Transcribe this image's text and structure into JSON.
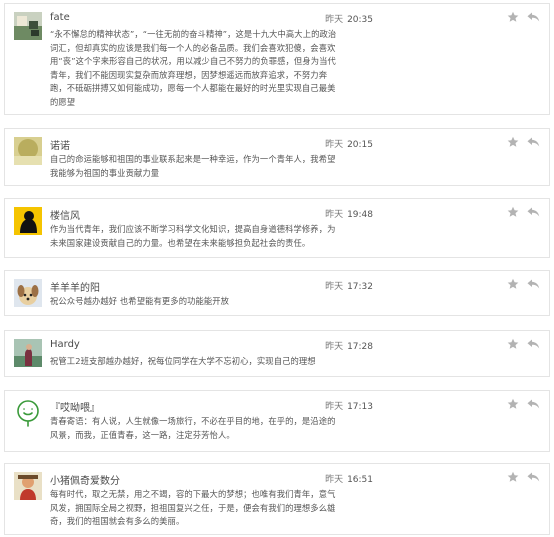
{
  "messages": [
    {
      "name": "fate",
      "day": "昨天",
      "time": "20:35",
      "text": "“永不懈怠的精神状态”，“一往无前的奋斗精神”，这是十九大中高大上的政治词汇，但却真实的应该是我们每一个人的必备品质。我们会喜欢犯傻，会喜欢用“丧”这个字来形容自己的状况，用以减少自己不努力的负罪感，但身为当代青年，我们不能因现实复杂而放弃理想，因梦想遥远而放弃追求，不努力奔跑，不砥砺拼搏又如何能成功，愿每一个人都能在最好的时光里实现自己最美的愿望",
      "avatar": "landscape-photo"
    },
    {
      "name": "诺诺",
      "day": "昨天",
      "time": "20:15",
      "text": "自己的命运能够和祖国的事业联系起来是一种幸运，作为一个青年人，我希望我能够为祖国的事业贡献力量",
      "avatar": "blurry-yellow-photo"
    },
    {
      "name": "楼信风",
      "day": "昨天",
      "time": "19:48",
      "text": "作为当代青年，我们应该不断学习科学文化知识，提高自身道德科学修养，为未来国家建设贡献自己的力量。也希望在未来能够担负起社会的责任。",
      "avatar": "cartoon-yellow"
    },
    {
      "name": "羊羊羊的阳",
      "day": "昨天",
      "time": "17:32",
      "text": "祝公众号越办越好 也希望能有更多的功能能开放",
      "avatar": "puppy-photo"
    },
    {
      "name": "Hardy",
      "day": "昨天",
      "time": "17:28",
      "text": "祝管工2班支部越办越好，祝每位同学在大学不忘初心，实现自己的理想",
      "avatar": "person-outdoor-photo"
    },
    {
      "name": "『哎呦喂』",
      "day": "昨天",
      "time": "17:13",
      "text": "青春寄语：有人说，人生就像一场旅行，不必在乎目的地，在乎的，是沿途的风景，而我，正值青春，这一路，注定芬芳怡人。",
      "avatar": "green-line-drawing"
    },
    {
      "name": "小猪佩奇爱数分",
      "day": "昨天",
      "time": "16:51",
      "text": "每有时代，取之无禁，用之不竭，容的下最大的梦想；也唯有我们青年，意气风发，拥国际全局之视野，担祖国复兴之任，于是，便会有我们的理想多么雄奇，我们的祖国就会有多么的美丽。",
      "avatar": "cartoon-character"
    }
  ],
  "icons": {
    "star": "star-icon",
    "reply": "reply-icon",
    "icon_color": "#b3b3b3"
  }
}
